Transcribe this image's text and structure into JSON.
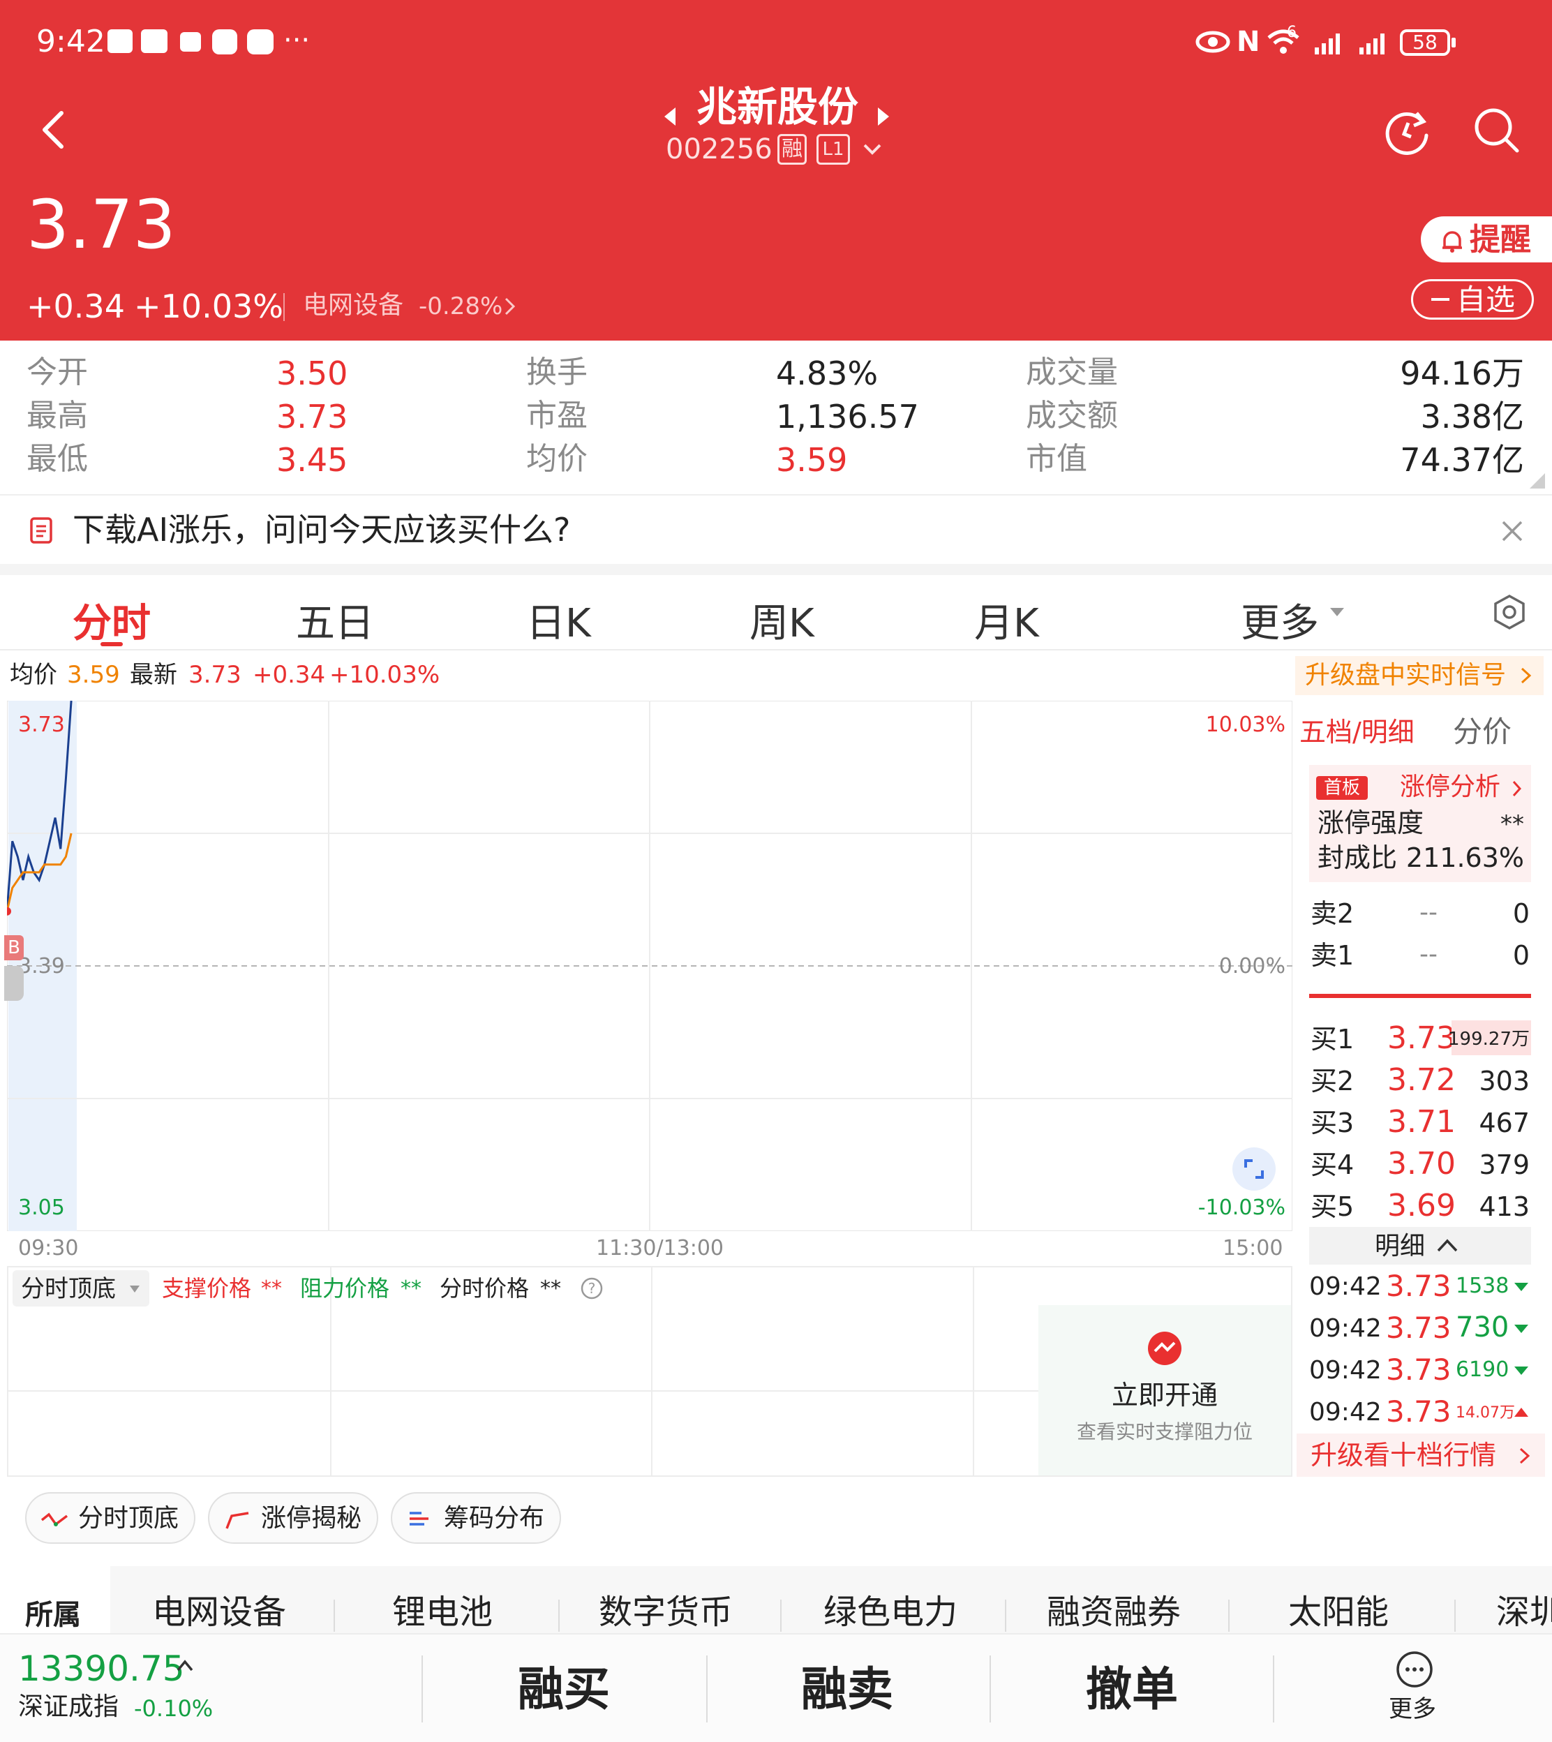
{
  "status_bar": {
    "time": "9:42",
    "battery": "58",
    "more_dots": "···",
    "nfc_label": "N",
    "signal_5g": "6"
  },
  "header": {
    "stock_name": "兆新股份",
    "stock_code": "002256",
    "tag_rong": "融",
    "tag_level": "L1"
  },
  "quote": {
    "price": "3.73",
    "change": "+0.34",
    "change_pct": "+10.03%",
    "sector_name": "电网设备",
    "sector_change": "-0.28%",
    "alert_button": "提醒",
    "watchlist_button": "自选"
  },
  "stats": {
    "open_label": "今开",
    "open_value": "3.50",
    "high_label": "最高",
    "high_value": "3.73",
    "low_label": "最低",
    "low_value": "3.45",
    "turnover_label": "换手",
    "turnover_value": "4.83%",
    "pe_label": "市盈",
    "pe_value": "1,136.57",
    "avg_label": "均价",
    "avg_value": "3.59",
    "volume_label": "成交量",
    "volume_value": "94.16万",
    "amount_label": "成交额",
    "amount_value": "3.38亿",
    "mktcap_label": "市值",
    "mktcap_value": "74.37亿"
  },
  "banner": {
    "text": "下载AI涨乐，问问今天应该买什么?"
  },
  "chart_tabs": [
    "分时",
    "五日",
    "日K",
    "周K",
    "月K",
    "更多"
  ],
  "chart_info": {
    "avg_label": "均价",
    "avg_value": "3.59",
    "latest_label": "最新",
    "latest_value": "3.73",
    "change": "+0.34",
    "change_pct": "+10.03%",
    "upgrade_link": "升级盘中实时信号"
  },
  "chart_data": {
    "type": "line",
    "x_ticks": [
      "09:30",
      "11:30/13:00",
      "15:00"
    ],
    "y_ticks_left": [
      "3.73",
      "3.39",
      "3.05"
    ],
    "y_ticks_right": [
      "10.03%",
      "0.00%",
      "-10.03%"
    ],
    "ylim": [
      3.05,
      3.73
    ],
    "prev_close": 3.39,
    "marker_label": "B",
    "series": [
      {
        "name": "",
        "color": "#1a3f8f",
        "x": [
          "09:30",
          "09:31",
          "09:32",
          "09:33",
          "09:34",
          "09:35",
          "09:36",
          "09:37",
          "09:38",
          "09:39",
          "09:40",
          "09:41",
          "09:42"
        ],
        "values": [
          3.46,
          3.55,
          3.53,
          3.5,
          3.53,
          3.51,
          3.5,
          3.52,
          3.55,
          3.58,
          3.54,
          3.63,
          3.73
        ]
      },
      {
        "name": "",
        "color": "#f08200",
        "x": [
          "09:30",
          "09:31",
          "09:32",
          "09:33",
          "09:34",
          "09:35",
          "09:36",
          "09:37",
          "09:38",
          "09:39",
          "09:40",
          "09:41",
          "09:42"
        ],
        "values": [
          3.46,
          3.49,
          3.5,
          3.51,
          3.51,
          3.51,
          3.51,
          3.52,
          3.52,
          3.52,
          3.52,
          3.53,
          3.56
        ]
      }
    ]
  },
  "indicator": {
    "dropdown": "分时顶底",
    "support_label": "支撑价格",
    "support_value": "**",
    "resist_label": "阻力价格",
    "resist_value": "**",
    "price_label": "分时价格",
    "price_value": "**",
    "open_title": "立即开通",
    "open_sub": "查看实时支撑阻力位"
  },
  "orderbook": {
    "tab_level5": "五档/明细",
    "tab_price": "分价",
    "first_board_tag": "首板",
    "limit_analysis": "涨停分析",
    "strength_label": "涨停强度",
    "strength_value": "**",
    "seal_label": "封成比",
    "seal_value": "211.63%",
    "asks": [
      {
        "label": "卖2",
        "price": "--",
        "vol": "0"
      },
      {
        "label": "卖1",
        "price": "--",
        "vol": "0"
      }
    ],
    "bids": [
      {
        "label": "买1",
        "price": "3.73",
        "vol": "199.27万"
      },
      {
        "label": "买2",
        "price": "3.72",
        "vol": "303"
      },
      {
        "label": "买3",
        "price": "3.71",
        "vol": "467"
      },
      {
        "label": "买4",
        "price": "3.70",
        "vol": "379"
      },
      {
        "label": "买5",
        "price": "3.69",
        "vol": "413"
      }
    ],
    "detail_toggle": "明细",
    "trades": [
      {
        "time": "09:42",
        "price": "3.73",
        "vol": "1538",
        "dir": "down"
      },
      {
        "time": "09:42",
        "price": "3.73",
        "vol": "730",
        "dir": "down"
      },
      {
        "time": "09:42",
        "price": "3.73",
        "vol": "6190",
        "dir": "down"
      },
      {
        "time": "09:42",
        "price": "3.73",
        "vol": "14.07万",
        "dir": "up"
      }
    ],
    "upgrade_ten": "升级看十档行情"
  },
  "feature_pills": [
    "分时顶底",
    "涨停揭秘",
    "筹码分布"
  ],
  "related": {
    "label": "所属",
    "items": [
      "电网设备",
      "锂电池",
      "数字货币",
      "绿色电力",
      "融资融券",
      "太阳能",
      "深圳"
    ]
  },
  "bottom_bar": {
    "index_value": "13390.75",
    "index_name": "深证成指",
    "index_change": "-0.10%",
    "buy": "融买",
    "sell": "融卖",
    "cancel": "撤单",
    "more": "更多"
  },
  "colors": {
    "header_red": "#e33538",
    "up_red": "#e93030",
    "down_green": "#14a043",
    "orange": "#f08200"
  }
}
